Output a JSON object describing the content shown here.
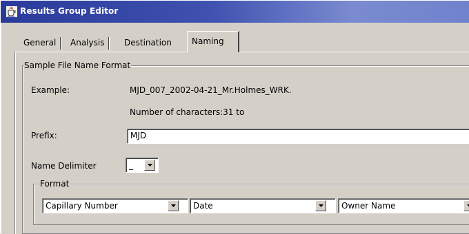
{
  "window": {
    "title": "Results Group Editor"
  },
  "tabs": [
    {
      "label": "General"
    },
    {
      "label": "Analysis"
    },
    {
      "label": "Destination"
    },
    {
      "label": "Naming"
    }
  ],
  "active_tab": "Naming",
  "sample_group": {
    "legend": "Sample File Name Format",
    "example_label": "Example:",
    "example_value": "MJD_007_2002-04-21_Mr.Holmes_WRK.",
    "char_count": "Number of characters:31 to",
    "prefix_label": "Prefix:",
    "prefix_value": "MJD",
    "delimiter_label": "Name Delimiter",
    "delimiter_value": "_"
  },
  "format_group": {
    "legend": "Format",
    "selects": [
      {
        "value": "Capillary Number"
      },
      {
        "value": "Date"
      },
      {
        "value": "Owner Name"
      }
    ]
  },
  "icons": {
    "app": "java-cup-icon",
    "dropdown": "chevron-down-icon"
  }
}
